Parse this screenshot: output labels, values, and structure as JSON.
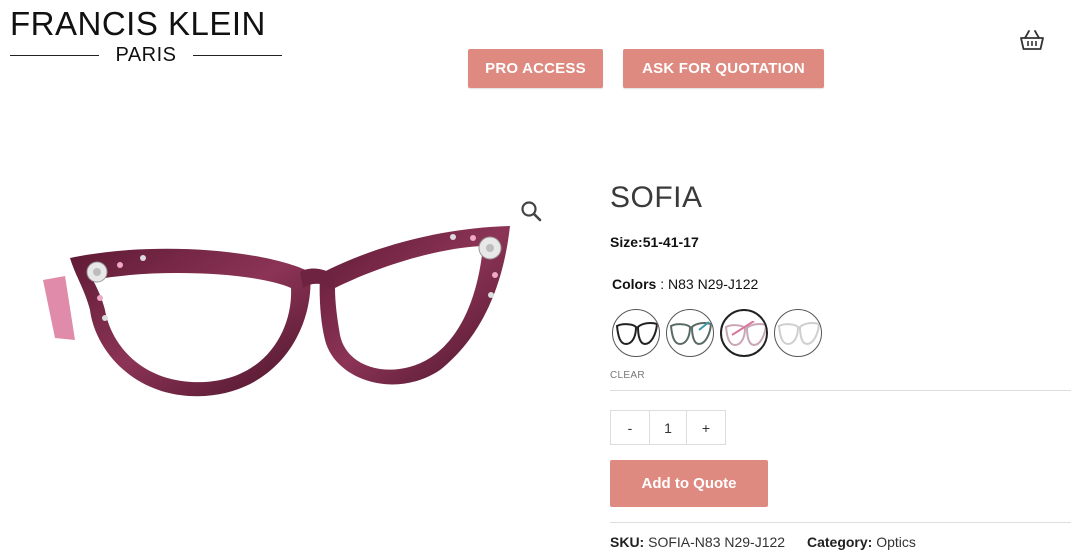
{
  "header": {
    "logo_main": "FRANCIS KLEIN",
    "logo_sub": "PARIS",
    "pro_access_label": "PRO ACCESS",
    "ask_quotation_label": "ASK FOR QUOTATION",
    "cart_icon": "basket-icon"
  },
  "product": {
    "title": "SOFIA",
    "size_label": "Size:",
    "size_value": "51-41-17",
    "colors_label": "Colors",
    "colors_separator": " : ",
    "colors_value": "N83 N29-J122",
    "swatches": [
      {
        "name": "black-frame",
        "frame_color": "#222222"
      },
      {
        "name": "grey-teal-frame",
        "frame_color": "#5a6a66"
      },
      {
        "name": "pink-clear-frame",
        "frame_color": "#c9a6b6"
      },
      {
        "name": "clear-frame",
        "frame_color": "#cfcfcf"
      }
    ],
    "selected_color_label": "CLEAR",
    "quantity_minus": "-",
    "quantity_value": "1",
    "quantity_plus": "+",
    "add_to_quote_label": "Add to Quote",
    "sku_label": "SKU:",
    "sku_value": "SOFIA-N83 N29-J122",
    "category_label": "Category:",
    "category_value": "Optics",
    "zoom_icon": "magnifier-icon"
  },
  "colors": {
    "accent": "#de8a80",
    "frame_main": "#7a2a45",
    "frame_highlight": "#c0607e"
  }
}
